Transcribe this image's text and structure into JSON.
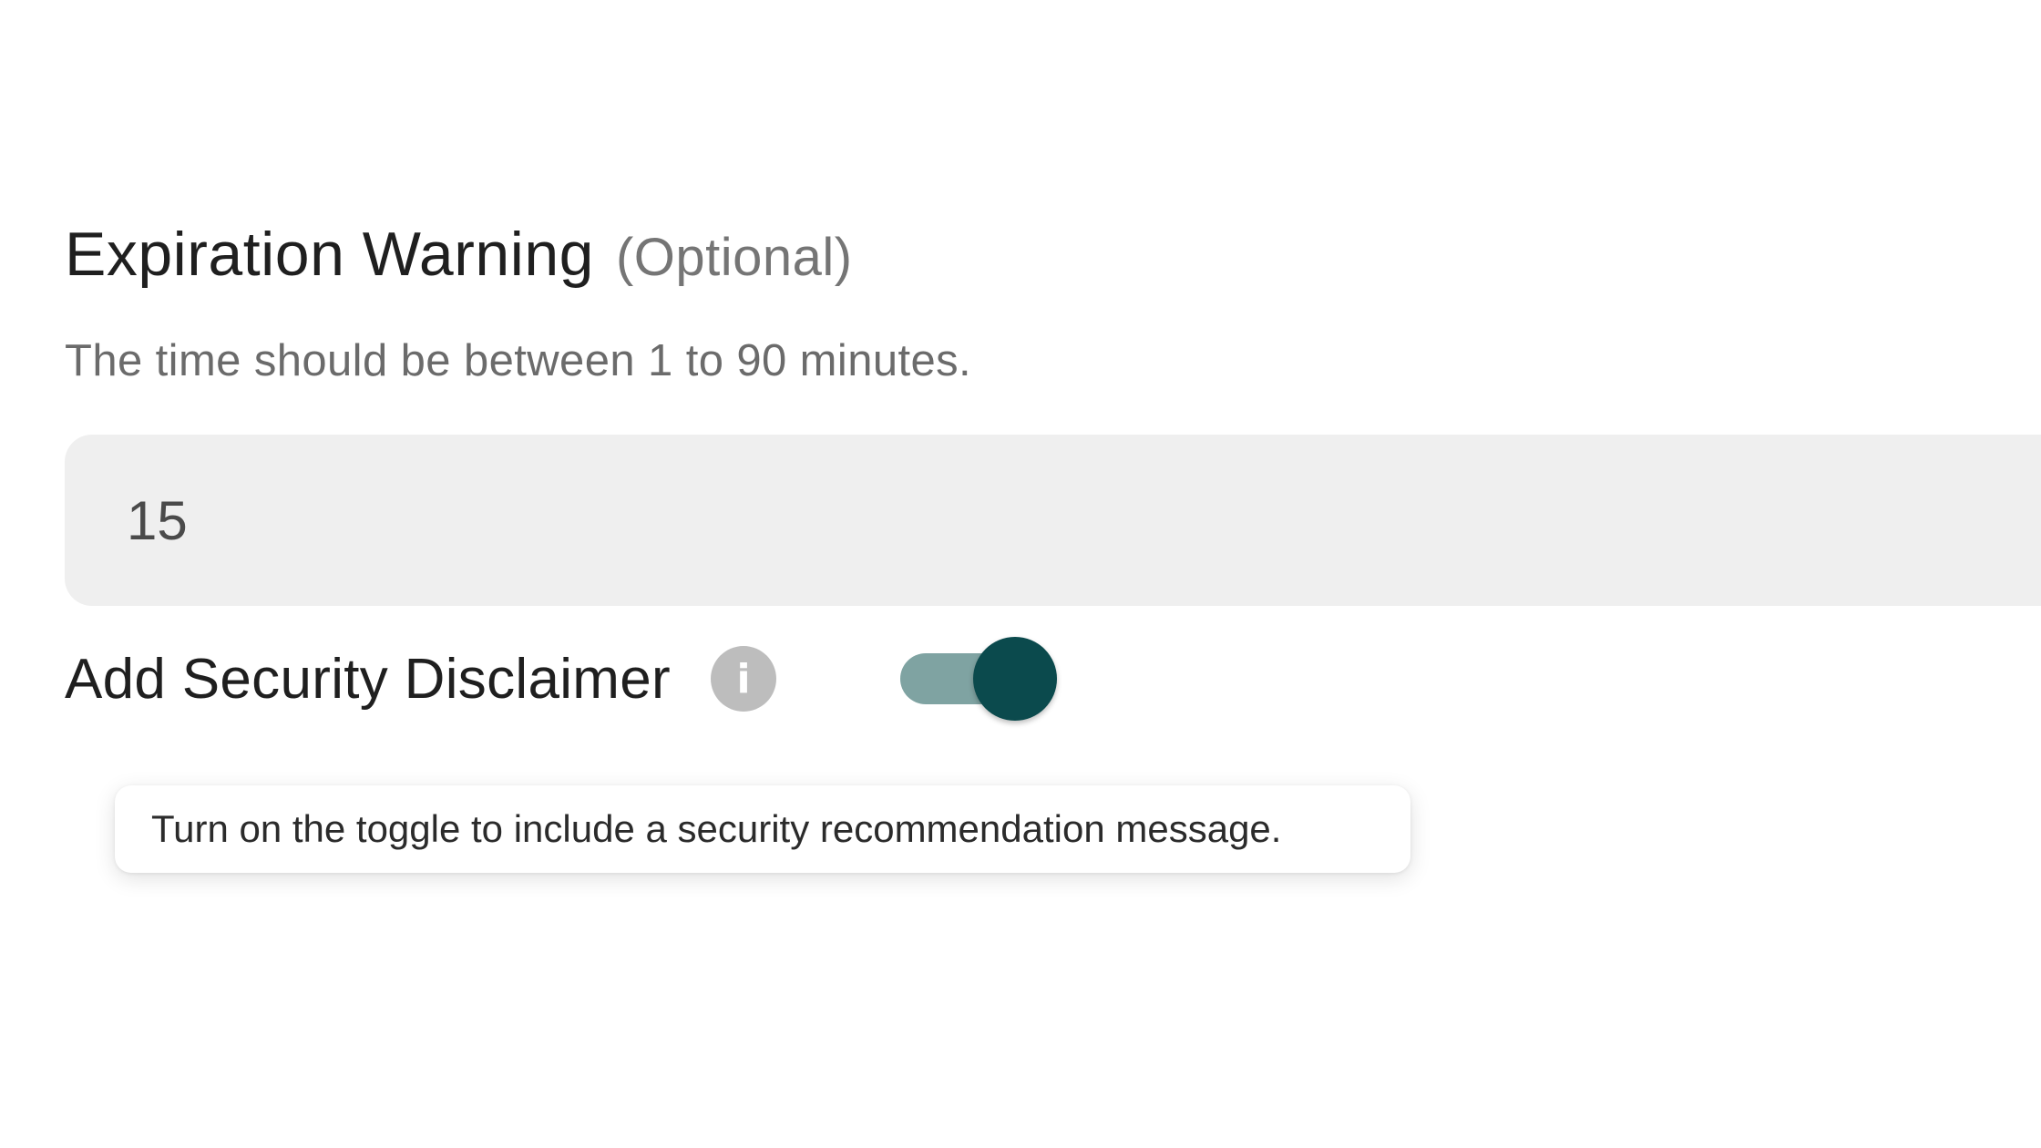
{
  "expiration_warning": {
    "title": "Expiration Warning",
    "optional_label": "(Optional)",
    "helper_text": "The time should be between 1 to 90 minutes.",
    "value": "15"
  },
  "security_disclaimer": {
    "label": "Add Security Disclaimer",
    "info_icon_glyph": "i",
    "info_icon": "info-icon",
    "toggle_on": true,
    "tooltip": "Turn on the toggle to include a security recommendation message."
  },
  "colors": {
    "toggle_thumb": "#0b4a4d",
    "toggle_track": "#7fa3a2",
    "input_background": "#efefef"
  }
}
